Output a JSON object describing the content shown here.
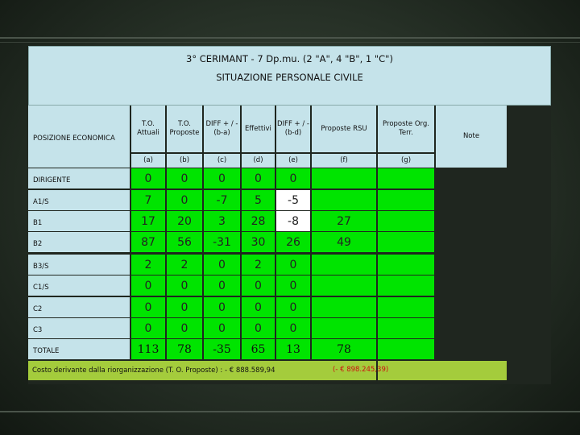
{
  "title": "3° CERIMANT - 7 Dp.mu. (2 \"A\", 4 \"B\", 1 \"C\")",
  "subtitle": "SITUAZIONE PERSONALE CIVILE",
  "table": {
    "col_headers": [
      "POSIZIONE ECONOMICA",
      "T.O. Attuali",
      "T.O. Proposte",
      "DIFF + / - (b-a)",
      "Effettivi",
      "DIFF + / - (b-d)",
      "Proposte RSU",
      "Proposte Org. Terr.",
      "Note"
    ],
    "col_letters": [
      "(a)",
      "(b)",
      "(c)",
      "(d)",
      "(e)",
      "(f)",
      "(g)"
    ],
    "rows": [
      {
        "label": "DIRIGENTE",
        "a": "0",
        "b": "0",
        "c": "0",
        "d": "0",
        "e": "0",
        "f": "",
        "g": ""
      },
      {
        "label": "A1/S",
        "a": "7",
        "b": "0",
        "c": "-7",
        "d": "5",
        "e": "-5",
        "f": "",
        "g": ""
      },
      {
        "label": "B1",
        "a": "17",
        "b": "20",
        "c": "3",
        "d": "28",
        "e": "-8",
        "f": "27",
        "g": ""
      },
      {
        "label": "B2",
        "a": "87",
        "b": "56",
        "c": "-31",
        "d": "30",
        "e": "26",
        "f": "49",
        "g": ""
      },
      {
        "label": "B3/S",
        "a": "2",
        "b": "2",
        "c": "0",
        "d": "2",
        "e": "0",
        "f": "",
        "g": ""
      },
      {
        "label": "C1/S",
        "a": "0",
        "b": "0",
        "c": "0",
        "d": "0",
        "e": "0",
        "f": "",
        "g": ""
      },
      {
        "label": "C2",
        "a": "0",
        "b": "0",
        "c": "0",
        "d": "0",
        "e": "0",
        "f": "",
        "g": ""
      },
      {
        "label": "C3",
        "a": "0",
        "b": "0",
        "c": "0",
        "d": "0",
        "e": "0",
        "f": "",
        "g": ""
      }
    ],
    "total": {
      "label": "TOTALE",
      "a": "113",
      "b": "78",
      "c": "-35",
      "d": "65",
      "e": "13",
      "f": "78",
      "g": ""
    }
  },
  "cost": {
    "label": "Costo derivante dalla riorganizzazione (T. O. Proposte) : - € 888.589,94",
    "alt": "(- € 898.245,39)"
  },
  "colors": {
    "green": "#00e400",
    "header_blue": "#c5e3ea",
    "cost_bar": "#a4cc3c",
    "cost_red": "#cc1111"
  }
}
